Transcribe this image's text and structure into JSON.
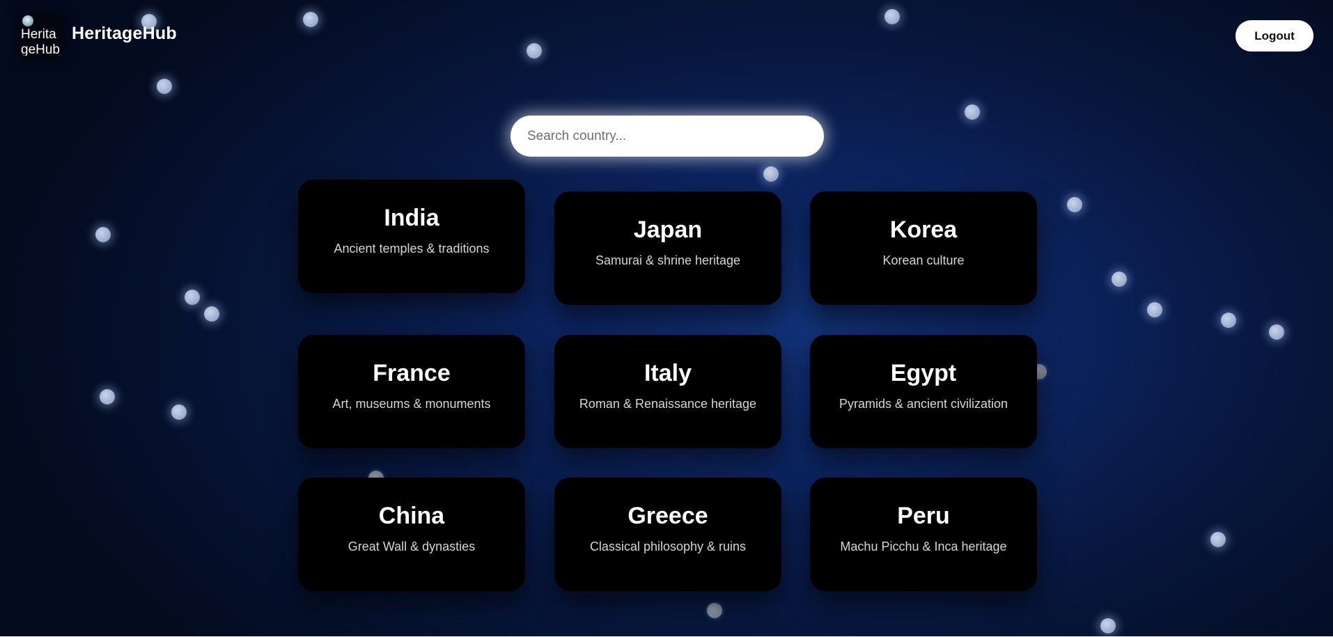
{
  "header": {
    "logo_alt": "HeritageHub Logo",
    "brand": "HeritageHub",
    "logout_label": "Logout"
  },
  "search": {
    "placeholder": "Search country..."
  },
  "countries": [
    {
      "name": "India",
      "description": "Ancient temples & traditions"
    },
    {
      "name": "Japan",
      "description": "Samurai & shrine heritage"
    },
    {
      "name": "Korea",
      "description": "Korean culture"
    },
    {
      "name": "France",
      "description": "Art, museums & monuments"
    },
    {
      "name": "Italy",
      "description": "Roman & Renaissance heritage"
    },
    {
      "name": "Egypt",
      "description": "Pyramids & ancient civilization"
    },
    {
      "name": "China",
      "description": "Great Wall & dynasties"
    },
    {
      "name": "Greece",
      "description": "Classical philosophy & ruins"
    },
    {
      "name": "Peru",
      "description": "Machu Picchu & Inca heritage"
    }
  ],
  "colors": {
    "background": "#0c2460",
    "card": "#000000",
    "orb": "#a9b8d6"
  }
}
